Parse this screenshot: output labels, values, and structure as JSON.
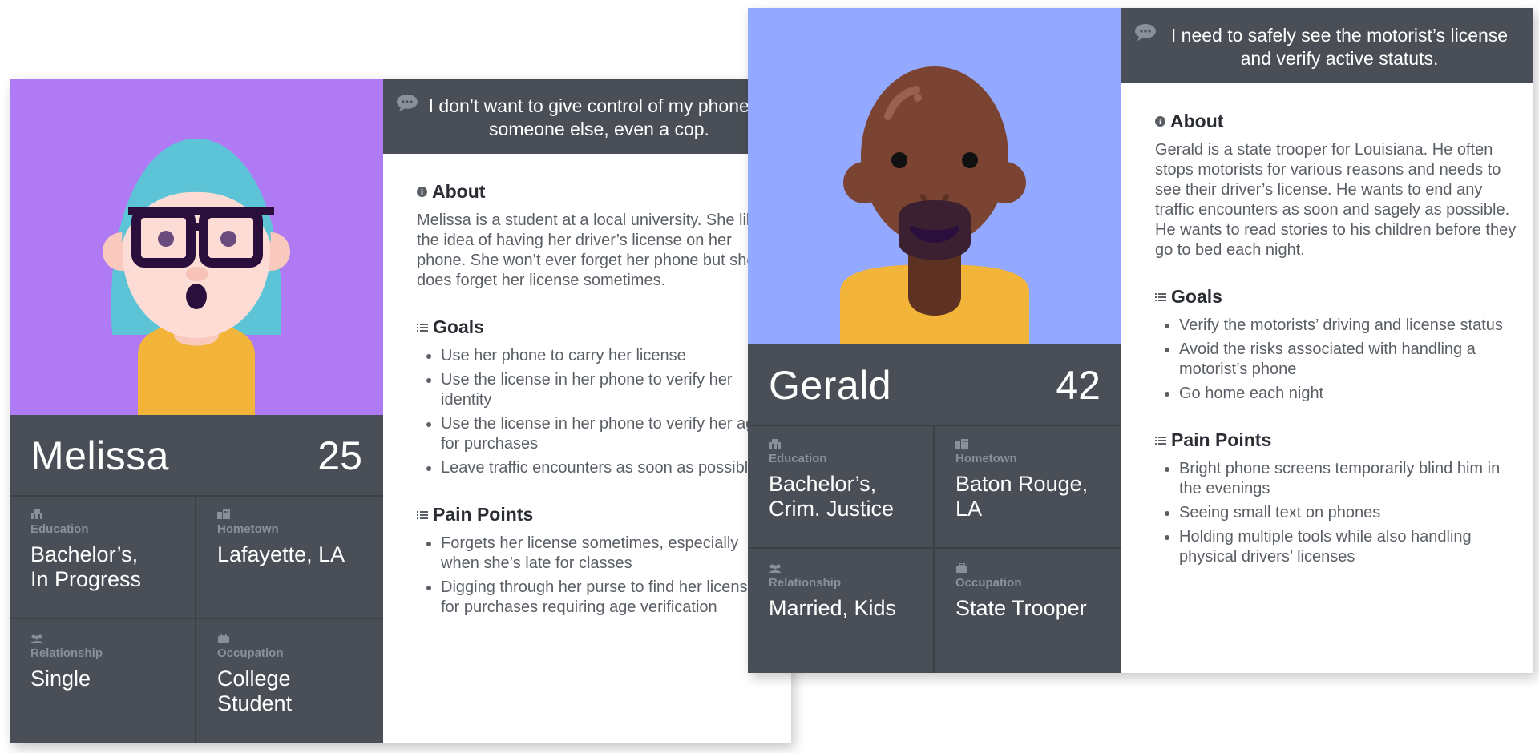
{
  "colors": {
    "melissa_bg": "#b07af4",
    "gerald_bg": "#93a8ff",
    "panel": "#4a4f57",
    "shirt": "#f3b43a"
  },
  "personas": [
    {
      "quote": "I don’t want to give control of my phone to someone else, even a cop.",
      "name": "Melissa",
      "age": "25",
      "about_title": "About",
      "about": "Melissa is a student at a local university. She likes the idea of having her driver’s license on her phone. She won’t ever forget her phone but she does forget her license sometimes.",
      "goals_title": "Goals",
      "goals": [
        "Use her phone to carry her license",
        "Use the license in her phone to verify her identity",
        "Use the license in her phone to verify her age for purchases",
        "Leave traffic encounters as soon as possible"
      ],
      "pain_title": "Pain Points",
      "pain_points": [
        "Forgets her license sometimes, especially when she’s late for classes",
        "Digging through her purse to find her license for purchases requiring age verification"
      ],
      "details": [
        {
          "label": "Education",
          "value": "Bachelor’s,\nIn Progress",
          "icon": "education-icon"
        },
        {
          "label": "Hometown",
          "value": "Lafayette, LA",
          "icon": "hometown-icon"
        },
        {
          "label": "Relationship",
          "value": "Single",
          "icon": "relationship-icon"
        },
        {
          "label": "Occupation",
          "value": "College\nStudent",
          "icon": "occupation-icon"
        }
      ]
    },
    {
      "quote": "I need to safely see the motorist’s license and verify active statuts.",
      "name": "Gerald",
      "age": "42",
      "about_title": "About",
      "about": "Gerald is a state trooper for Louisiana. He often stops motorists for various reasons and needs to see their driver’s license. He wants to end any traffic encounters as soon and sagely as possible. He wants to read stories to his children before they go to bed each night.",
      "goals_title": "Goals",
      "goals": [
        "Verify the motorists’ driving and license status",
        "Avoid the risks associated with handling a motorist’s phone",
        "Go home each night"
      ],
      "pain_title": "Pain Points",
      "pain_points": [
        "Bright phone screens temporarily blind him in the evenings",
        "Seeing small text on phones",
        "Holding multiple tools while also handling physical drivers’ licenses"
      ],
      "details": [
        {
          "label": "Education",
          "value": "Bachelor’s,\nCrim. Justice",
          "icon": "education-icon"
        },
        {
          "label": "Hometown",
          "value": "Baton Rouge,\nLA",
          "icon": "hometown-icon"
        },
        {
          "label": "Relationship",
          "value": "Married, Kids",
          "icon": "relationship-icon"
        },
        {
          "label": "Occupation",
          "value": "State Trooper",
          "icon": "occupation-icon"
        }
      ]
    }
  ]
}
